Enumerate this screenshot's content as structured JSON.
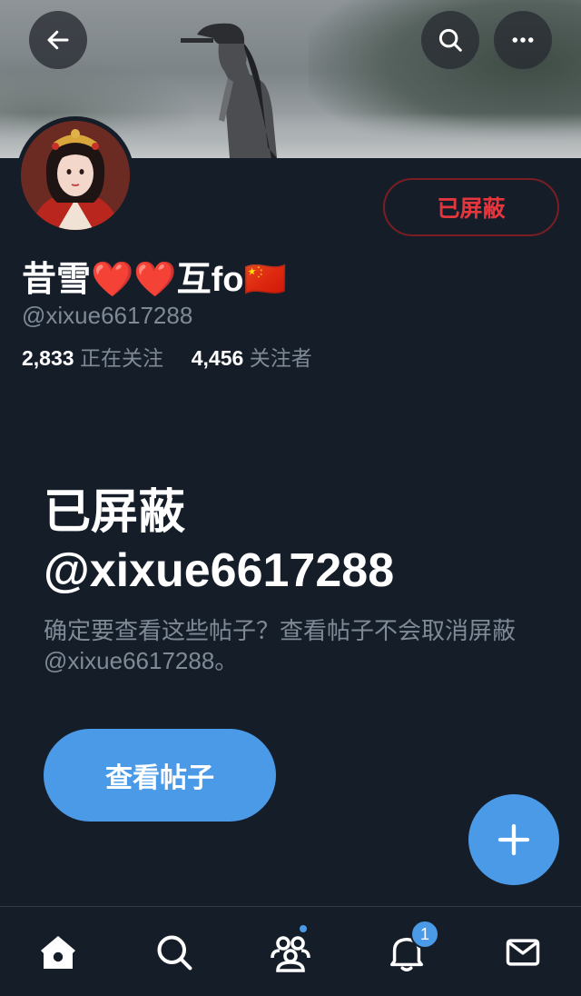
{
  "header": {
    "back_icon": "arrow-left-icon",
    "search_icon": "search-icon",
    "more_icon": "more-horizontal-icon"
  },
  "profile": {
    "display_name": "昔雪❤️❤️互fo🇨🇳",
    "handle": "@xixue6617288",
    "blocked_label": "已屏蔽",
    "following_count": "2,833",
    "following_label": "正在关注",
    "followers_count": "4,456",
    "followers_label": "关注者"
  },
  "blocked_notice": {
    "title": "已屏蔽",
    "handle": "@xixue6617288",
    "description": "确定要查看这些帖子？查看帖子不会取消屏蔽@xixue6617288。",
    "view_posts_label": "查看帖子"
  },
  "fab": {
    "icon": "plus-icon"
  },
  "bottom_nav": {
    "items": [
      {
        "name": "home",
        "icon": "home-icon"
      },
      {
        "name": "search",
        "icon": "search-icon"
      },
      {
        "name": "communities",
        "icon": "communities-icon"
      },
      {
        "name": "notifications",
        "icon": "bell-icon",
        "badge": "1"
      },
      {
        "name": "messages",
        "icon": "mail-icon"
      }
    ]
  },
  "colors": {
    "background": "#151d29",
    "accent": "#4b9ae8",
    "blocked_red": "#e5353d",
    "muted_text": "#7f8a97"
  }
}
